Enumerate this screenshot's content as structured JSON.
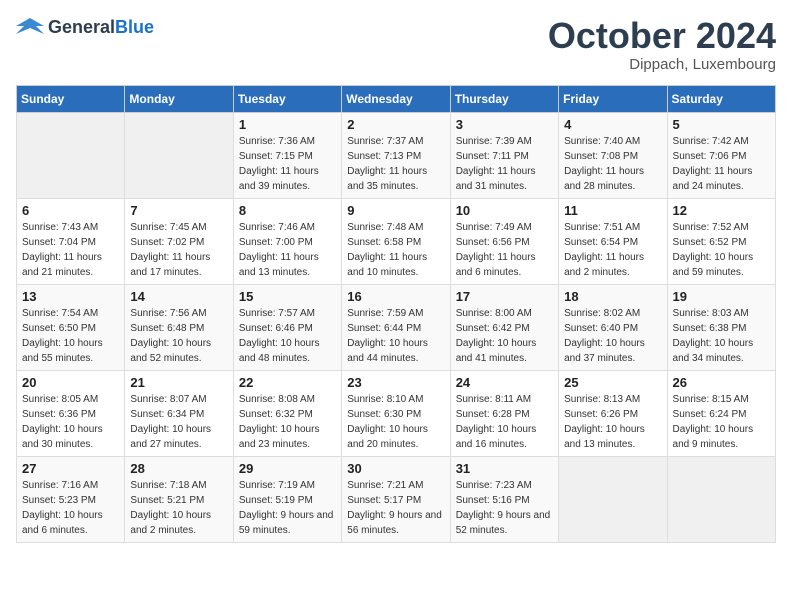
{
  "header": {
    "logo_general": "General",
    "logo_blue": "Blue",
    "title": "October 2024",
    "location": "Dippach, Luxembourg"
  },
  "days_of_week": [
    "Sunday",
    "Monday",
    "Tuesday",
    "Wednesday",
    "Thursday",
    "Friday",
    "Saturday"
  ],
  "weeks": [
    [
      {
        "day": "",
        "info": ""
      },
      {
        "day": "",
        "info": ""
      },
      {
        "day": "1",
        "info": "Sunrise: 7:36 AM\nSunset: 7:15 PM\nDaylight: 11 hours and 39 minutes."
      },
      {
        "day": "2",
        "info": "Sunrise: 7:37 AM\nSunset: 7:13 PM\nDaylight: 11 hours and 35 minutes."
      },
      {
        "day": "3",
        "info": "Sunrise: 7:39 AM\nSunset: 7:11 PM\nDaylight: 11 hours and 31 minutes."
      },
      {
        "day": "4",
        "info": "Sunrise: 7:40 AM\nSunset: 7:08 PM\nDaylight: 11 hours and 28 minutes."
      },
      {
        "day": "5",
        "info": "Sunrise: 7:42 AM\nSunset: 7:06 PM\nDaylight: 11 hours and 24 minutes."
      }
    ],
    [
      {
        "day": "6",
        "info": "Sunrise: 7:43 AM\nSunset: 7:04 PM\nDaylight: 11 hours and 21 minutes."
      },
      {
        "day": "7",
        "info": "Sunrise: 7:45 AM\nSunset: 7:02 PM\nDaylight: 11 hours and 17 minutes."
      },
      {
        "day": "8",
        "info": "Sunrise: 7:46 AM\nSunset: 7:00 PM\nDaylight: 11 hours and 13 minutes."
      },
      {
        "day": "9",
        "info": "Sunrise: 7:48 AM\nSunset: 6:58 PM\nDaylight: 11 hours and 10 minutes."
      },
      {
        "day": "10",
        "info": "Sunrise: 7:49 AM\nSunset: 6:56 PM\nDaylight: 11 hours and 6 minutes."
      },
      {
        "day": "11",
        "info": "Sunrise: 7:51 AM\nSunset: 6:54 PM\nDaylight: 11 hours and 2 minutes."
      },
      {
        "day": "12",
        "info": "Sunrise: 7:52 AM\nSunset: 6:52 PM\nDaylight: 10 hours and 59 minutes."
      }
    ],
    [
      {
        "day": "13",
        "info": "Sunrise: 7:54 AM\nSunset: 6:50 PM\nDaylight: 10 hours and 55 minutes."
      },
      {
        "day": "14",
        "info": "Sunrise: 7:56 AM\nSunset: 6:48 PM\nDaylight: 10 hours and 52 minutes."
      },
      {
        "day": "15",
        "info": "Sunrise: 7:57 AM\nSunset: 6:46 PM\nDaylight: 10 hours and 48 minutes."
      },
      {
        "day": "16",
        "info": "Sunrise: 7:59 AM\nSunset: 6:44 PM\nDaylight: 10 hours and 44 minutes."
      },
      {
        "day": "17",
        "info": "Sunrise: 8:00 AM\nSunset: 6:42 PM\nDaylight: 10 hours and 41 minutes."
      },
      {
        "day": "18",
        "info": "Sunrise: 8:02 AM\nSunset: 6:40 PM\nDaylight: 10 hours and 37 minutes."
      },
      {
        "day": "19",
        "info": "Sunrise: 8:03 AM\nSunset: 6:38 PM\nDaylight: 10 hours and 34 minutes."
      }
    ],
    [
      {
        "day": "20",
        "info": "Sunrise: 8:05 AM\nSunset: 6:36 PM\nDaylight: 10 hours and 30 minutes."
      },
      {
        "day": "21",
        "info": "Sunrise: 8:07 AM\nSunset: 6:34 PM\nDaylight: 10 hours and 27 minutes."
      },
      {
        "day": "22",
        "info": "Sunrise: 8:08 AM\nSunset: 6:32 PM\nDaylight: 10 hours and 23 minutes."
      },
      {
        "day": "23",
        "info": "Sunrise: 8:10 AM\nSunset: 6:30 PM\nDaylight: 10 hours and 20 minutes."
      },
      {
        "day": "24",
        "info": "Sunrise: 8:11 AM\nSunset: 6:28 PM\nDaylight: 10 hours and 16 minutes."
      },
      {
        "day": "25",
        "info": "Sunrise: 8:13 AM\nSunset: 6:26 PM\nDaylight: 10 hours and 13 minutes."
      },
      {
        "day": "26",
        "info": "Sunrise: 8:15 AM\nSunset: 6:24 PM\nDaylight: 10 hours and 9 minutes."
      }
    ],
    [
      {
        "day": "27",
        "info": "Sunrise: 7:16 AM\nSunset: 5:23 PM\nDaylight: 10 hours and 6 minutes."
      },
      {
        "day": "28",
        "info": "Sunrise: 7:18 AM\nSunset: 5:21 PM\nDaylight: 10 hours and 2 minutes."
      },
      {
        "day": "29",
        "info": "Sunrise: 7:19 AM\nSunset: 5:19 PM\nDaylight: 9 hours and 59 minutes."
      },
      {
        "day": "30",
        "info": "Sunrise: 7:21 AM\nSunset: 5:17 PM\nDaylight: 9 hours and 56 minutes."
      },
      {
        "day": "31",
        "info": "Sunrise: 7:23 AM\nSunset: 5:16 PM\nDaylight: 9 hours and 52 minutes."
      },
      {
        "day": "",
        "info": ""
      },
      {
        "day": "",
        "info": ""
      }
    ]
  ]
}
